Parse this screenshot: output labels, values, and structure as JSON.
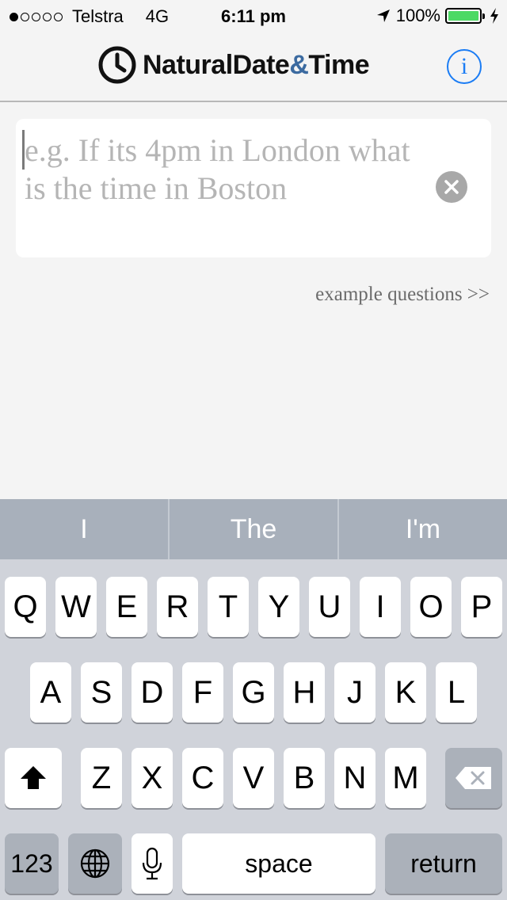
{
  "status": {
    "carrier": "Telstra",
    "network": "4G",
    "time": "6:11 pm",
    "battery": "100%",
    "battery_level": 1.0
  },
  "app": {
    "logo_name": "NaturalDate",
    "logo_amp": "&",
    "logo_time": "Time",
    "info_label": "i"
  },
  "question": {
    "placeholder": "e.g. If its 4pm in London what is the time in Boston",
    "example_link": "example questions >>"
  },
  "suggestions": [
    "I",
    "The",
    "I'm"
  ],
  "keyboard": {
    "row1": [
      "Q",
      "W",
      "E",
      "R",
      "T",
      "Y",
      "U",
      "I",
      "O",
      "P"
    ],
    "row2": [
      "A",
      "S",
      "D",
      "F",
      "G",
      "H",
      "J",
      "K",
      "L"
    ],
    "row3": [
      "Z",
      "X",
      "C",
      "V",
      "B",
      "N",
      "M"
    ],
    "numbers_label": "123",
    "space_label": "space",
    "return_label": "return"
  },
  "icons": {
    "status": [
      "location-arrow-icon",
      "charging-bolt-icon"
    ],
    "nav": [
      "clock-logo-icon",
      "info-icon"
    ],
    "input": [
      "clear-icon"
    ],
    "keyboard": [
      "shift-icon",
      "delete-icon",
      "globe-icon",
      "microphone-icon"
    ]
  }
}
